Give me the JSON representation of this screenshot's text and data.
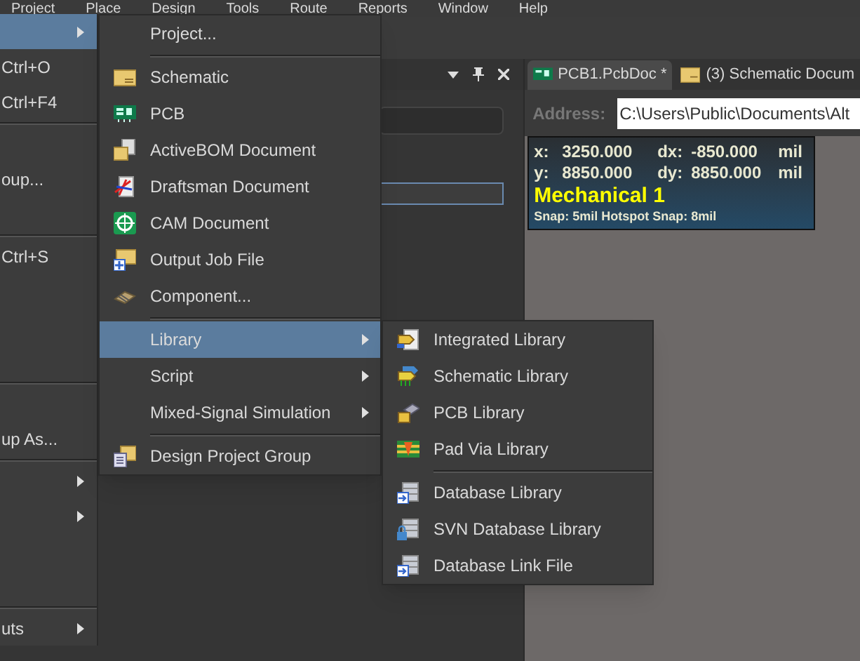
{
  "menubar": [
    "Project",
    "Place",
    "Design",
    "Tools",
    "Route",
    "Reports",
    "Window",
    "Help"
  ],
  "file_menu": [
    {
      "kind": "item",
      "selected": true,
      "has_submenu": true
    },
    {
      "kind": "item",
      "shortcut": "Ctrl+O",
      "selected": false,
      "has_submenu": false
    },
    {
      "kind": "item",
      "shortcut": "Ctrl+F4",
      "selected": false,
      "has_submenu": false
    },
    {
      "kind": "separator"
    },
    {
      "kind": "blank"
    },
    {
      "kind": "item",
      "label": "oup...",
      "selected": false,
      "has_submenu": false
    },
    {
      "kind": "blank"
    },
    {
      "kind": "separator"
    },
    {
      "kind": "item",
      "shortcut": "Ctrl+S",
      "selected": false,
      "has_submenu": false
    },
    {
      "kind": "blank"
    },
    {
      "kind": "blank"
    },
    {
      "kind": "blank"
    },
    {
      "kind": "separator"
    },
    {
      "kind": "blank"
    },
    {
      "kind": "item",
      "label": "up As...",
      "selected": false,
      "has_submenu": false
    },
    {
      "kind": "separator"
    },
    {
      "kind": "item",
      "selected": false,
      "has_submenu": true
    },
    {
      "kind": "item",
      "selected": false,
      "has_submenu": true
    },
    {
      "kind": "blank"
    },
    {
      "kind": "blank"
    },
    {
      "kind": "separator"
    },
    {
      "kind": "item",
      "label": "uts",
      "selected": false,
      "has_submenu": true
    }
  ],
  "new_menu": [
    {
      "label": "Project...",
      "selected": false,
      "has_submenu": false
    },
    {
      "kind": "separator"
    },
    {
      "label": "Schematic",
      "selected": false,
      "has_submenu": false
    },
    {
      "label": "PCB",
      "selected": false,
      "has_submenu": false
    },
    {
      "label": "ActiveBOM Document",
      "selected": false,
      "has_submenu": false
    },
    {
      "label": "Draftsman Document",
      "selected": false,
      "has_submenu": false
    },
    {
      "label": "CAM Document",
      "selected": false,
      "has_submenu": false
    },
    {
      "label": "Output Job File",
      "selected": false,
      "has_submenu": false
    },
    {
      "label": "Component...",
      "selected": false,
      "has_submenu": false
    },
    {
      "kind": "separator"
    },
    {
      "label": "Library",
      "selected": true,
      "has_submenu": true
    },
    {
      "label": "Script",
      "selected": false,
      "has_submenu": true
    },
    {
      "label": "Mixed-Signal Simulation",
      "selected": false,
      "has_submenu": true
    },
    {
      "kind": "separator"
    },
    {
      "label": "Design Project Group",
      "selected": false,
      "has_submenu": false
    }
  ],
  "library_menu": [
    {
      "label": "Integrated Library",
      "selected": false
    },
    {
      "label": "Schematic Library",
      "selected": false
    },
    {
      "label": "PCB Library",
      "selected": false
    },
    {
      "label": "Pad Via Library",
      "selected": false
    },
    {
      "kind": "separator"
    },
    {
      "label": "Database Library",
      "selected": false
    },
    {
      "label": "SVN Database Library",
      "selected": false
    },
    {
      "label": "Database Link File",
      "selected": false
    }
  ],
  "document_tabs": [
    {
      "label": "PCB1.PcbDoc *",
      "selected": true
    },
    {
      "label": "(3) Schematic Docum",
      "selected": false
    }
  ],
  "address": {
    "label": "Address:",
    "value": "C:\\Users\\Public\\Documents\\Alt"
  },
  "hud": {
    "rows": [
      {
        "axis": "x:",
        "value": "3250.000",
        "delta_label": "dx:",
        "delta": "-850.000",
        "unit": "mil"
      },
      {
        "axis": "y:",
        "value": "8850.000",
        "delta_label": "dy:",
        "delta": "8850.000",
        "unit": "mil"
      }
    ],
    "layer": "Mechanical 1",
    "snap": "Snap: 5mil Hotspot Snap: 8mil"
  }
}
